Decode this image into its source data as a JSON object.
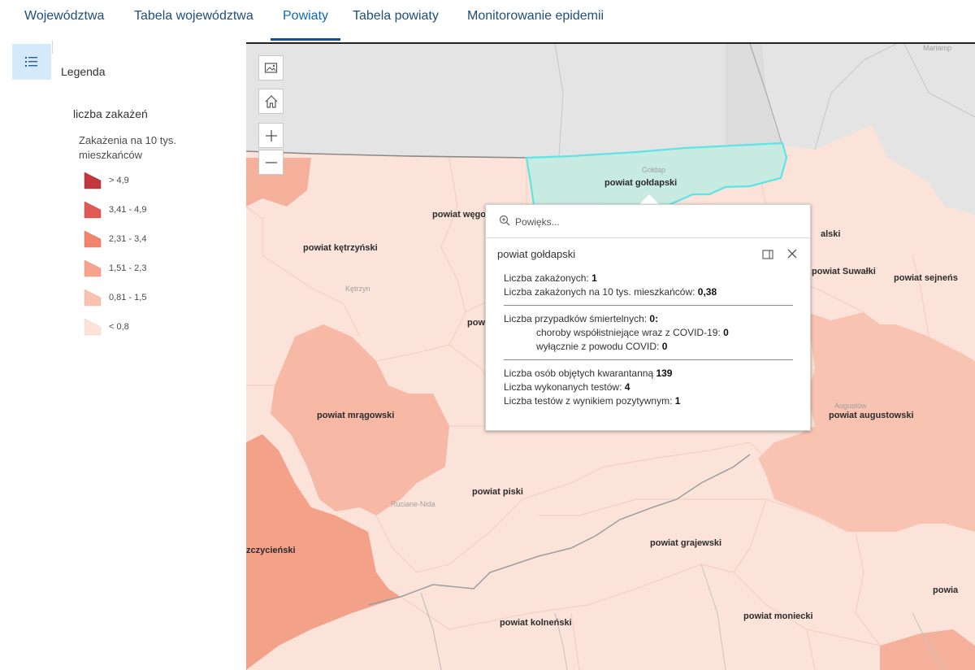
{
  "tabs": [
    {
      "label": "Województwa",
      "active": false
    },
    {
      "label": "Tabela województwa",
      "active": false
    },
    {
      "label": "Powiaty",
      "active": true
    },
    {
      "label": "Tabela powiaty",
      "active": false
    },
    {
      "label": "Monitorowanie epidemii",
      "active": false
    }
  ],
  "legend": {
    "header": "Legenda",
    "layer_title": "liczba zakażeń",
    "field_label": "Zakażenia na 10 tys. mieszkańców",
    "items": [
      {
        "label": "> 4,9",
        "color": "#c0373e"
      },
      {
        "label": "3,41 - 4,9",
        "color": "#e05a55"
      },
      {
        "label": "2,31 - 3,4",
        "color": "#f2846c"
      },
      {
        "label": "1,51 - 2,3",
        "color": "#f5a38c"
      },
      {
        "label": "0,81 - 1,5",
        "color": "#f8c3b1"
      },
      {
        "label": "< 0,8",
        "color": "#fbe3d9"
      }
    ]
  },
  "map": {
    "highlight_color": "#5fe3e6",
    "labels": {
      "goldapski": "powiat gołdapski",
      "wegorzewski": "powiat węgo",
      "ketrzynski": "powiat kętrzyński",
      "mragowski": "powiat mrągowski",
      "piski": "powiat piski",
      "grajewski": "powiat grajewski",
      "kolnenski": "powiat kolneński",
      "moniecki": "powiat moniecki",
      "augustowski": "powiat augustowski",
      "suwalki": "powiat Suwałki",
      "sejnenski": "powiat sejneńs",
      "szczycienski": "zczycieński",
      "suwalski": "alski",
      "pow_partial": "pow",
      "pow_right": "powia"
    },
    "towns": {
      "ketrzyn": "Kętrzyn",
      "ruciane": "Ruciane-Nida",
      "augustow": "Augustów",
      "goldap": "Gołdap",
      "mariampol": "Mariamp"
    }
  },
  "popup": {
    "search_placeholder": "Powięks...",
    "title": "powiat gołdapski",
    "rows": [
      {
        "label": "Liczba zakażonych: ",
        "value": "1"
      },
      {
        "label": "Liczba zakażonych na 10 tys. mieszkańców: ",
        "value": "0,38"
      },
      {
        "label": "Liczba przypadków śmiertelnych: ",
        "value": "0:"
      },
      {
        "label": "choroby współistniejące wraz z COVID-19: ",
        "value": "0"
      },
      {
        "label": "wyłącznie z powodu COVID: ",
        "value": "0"
      },
      {
        "label": "Liczba osób objętych kwarantanną ",
        "value": "139"
      },
      {
        "label": "Liczba wykonanych testów: ",
        "value": "4"
      },
      {
        "label": "Liczba testów z wynikiem pozytywnym: ",
        "value": "1"
      }
    ]
  }
}
